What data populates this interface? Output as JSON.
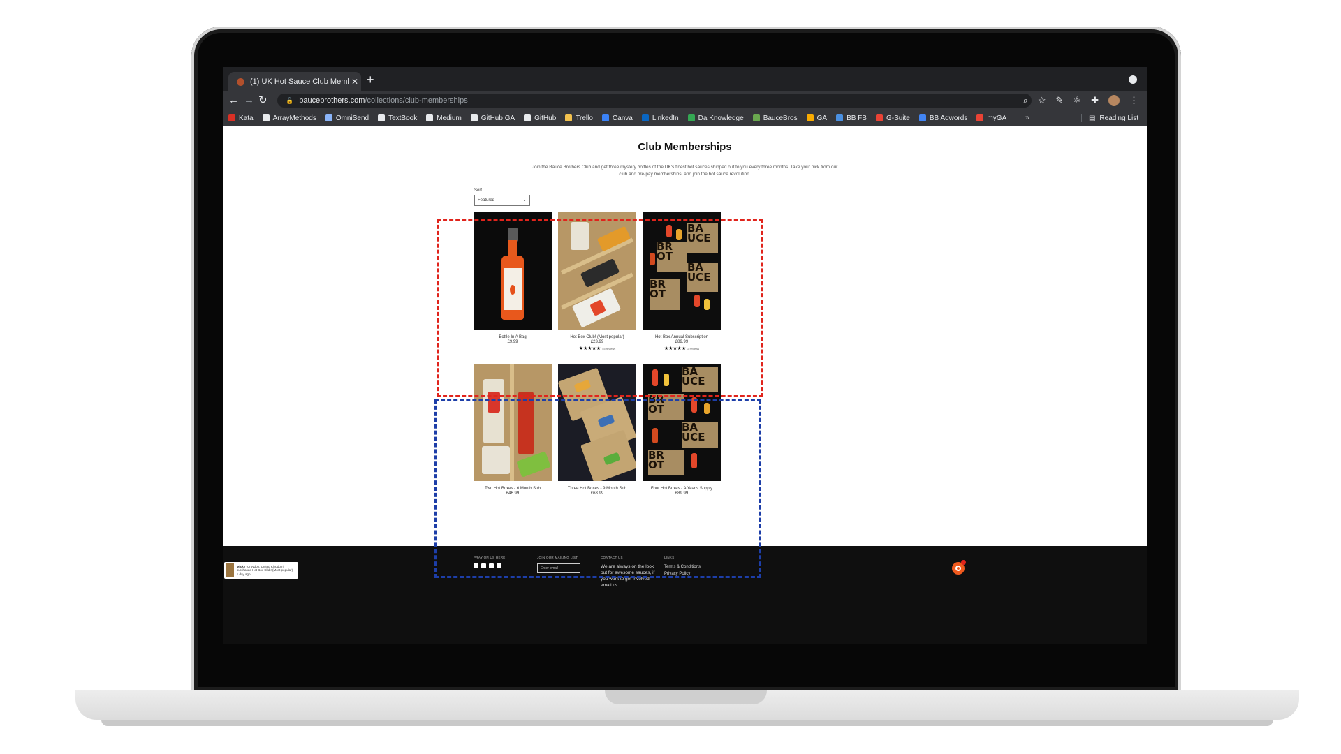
{
  "browser": {
    "tab_title": "(1) UK Hot Sauce Club Membe",
    "tab_close": "✕",
    "new_tab": "+",
    "url_host": "baucebrothers.com",
    "url_path": "/collections/club-memberships",
    "bookmarks": [
      "Kata",
      "ArrayMethods",
      "OmniSend",
      "TextBook",
      "Medium",
      "GitHub GA",
      "GitHub",
      "Trello",
      "Canva",
      "LinkedIn",
      "Da Knowledge",
      "BauceBros",
      "GA",
      "BB FB",
      "G-Suite",
      "BB Adwords",
      "myGA"
    ],
    "bookmark_colors": [
      "#d93025",
      "#e8eaed",
      "#8ab4f8",
      "#e8eaed",
      "#e8eaed",
      "#e8eaed",
      "#e8eaed",
      "#f2c14e",
      "#3b82f6",
      "#0a66c2",
      "#34a853",
      "#6aa84f",
      "#f9ab00",
      "#4a90e2",
      "#ea4335",
      "#4285f4",
      "#ea4335"
    ],
    "more": "»",
    "reading_list": "Reading List"
  },
  "page": {
    "title": "Club Memberships",
    "intro": "Join the Bauce Brothers Club and get three mystery bottles of the UK's finest hot sauces shipped out to you every three months. Take your pick from our club and pre-pay memberships, and join the hot sauce revolution.",
    "sort_label": "Sort",
    "sort_value": "Featured"
  },
  "products": [
    {
      "name": "Bottle In A Bag",
      "price": "£9.99"
    },
    {
      "name": "Hot Box Club! (Most popular)",
      "price": "£23.99",
      "stars": "★★★★★",
      "reviews": "45 reviews"
    },
    {
      "name": "Hot Box Annual Subscription",
      "price": "£89.99",
      "stars": "★★★★★",
      "reviews": "2 reviews"
    },
    {
      "name": "Two Hot Boxes - 6 Month Sub",
      "price": "£46.99"
    },
    {
      "name": "Three Hot Boxes - 9 Month Sub",
      "price": "£68.99"
    },
    {
      "name": "Four Hot Boxes - A Year's Supply",
      "price": "£89.99"
    }
  ],
  "footer": {
    "col1_heading": "PRAY ON US HERE",
    "col2_heading": "JOIN OUR MAILING LIST",
    "email_placeholder": "Enter email",
    "col3_heading": "CONTACT US",
    "contact_text": "We are always on the look out for awesome sauces, if you want to get involved, email us",
    "col4_heading": "LINKS",
    "link1": "Terms & Conditions",
    "link2": "Privacy Policy"
  },
  "popup": {
    "name": "Micky",
    "line": "(Croydon, United Kingdom) purchased Hot Box Club! (Most popular)",
    "time": "1 day ago"
  },
  "colors": {
    "highlight_red": "#e0241c",
    "highlight_blue": "#1d3ea8",
    "chat_orange": "#f05a1e"
  }
}
